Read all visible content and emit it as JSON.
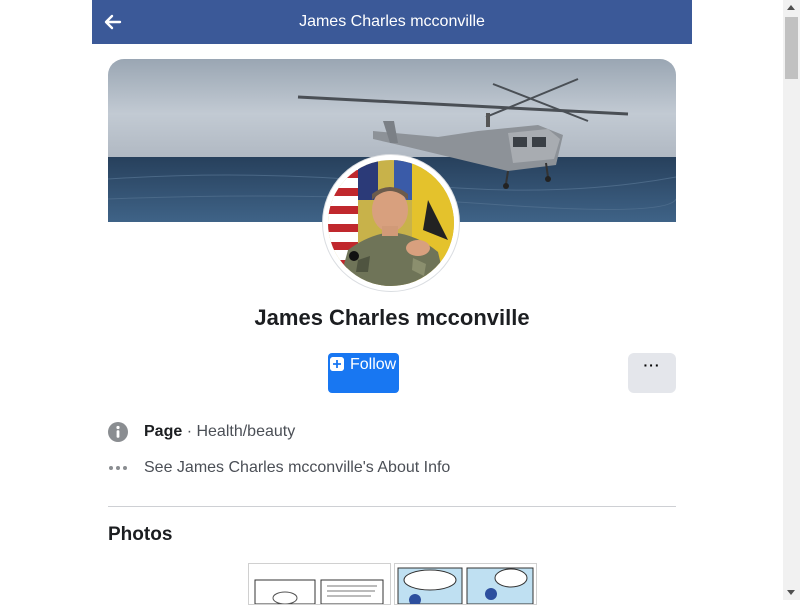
{
  "header": {
    "title": "James Charles mcconville"
  },
  "profile": {
    "name": "James Charles mcconville",
    "follow_label": "Follow",
    "more_label": "···"
  },
  "info": {
    "category_prefix": "Page",
    "category_separator": " · ",
    "category": "Health/beauty",
    "about_link": "See James Charles mcconville's About Info"
  },
  "photos": {
    "title": "Photos"
  },
  "colors": {
    "header_bg": "#3b5998",
    "follow_bg": "#1877f2",
    "more_bg": "#e4e6eb"
  },
  "icons": {
    "back": "arrow-left-icon",
    "info": "info-circle-icon",
    "more": "more-dots-icon",
    "follow": "follow-plus-icon"
  }
}
